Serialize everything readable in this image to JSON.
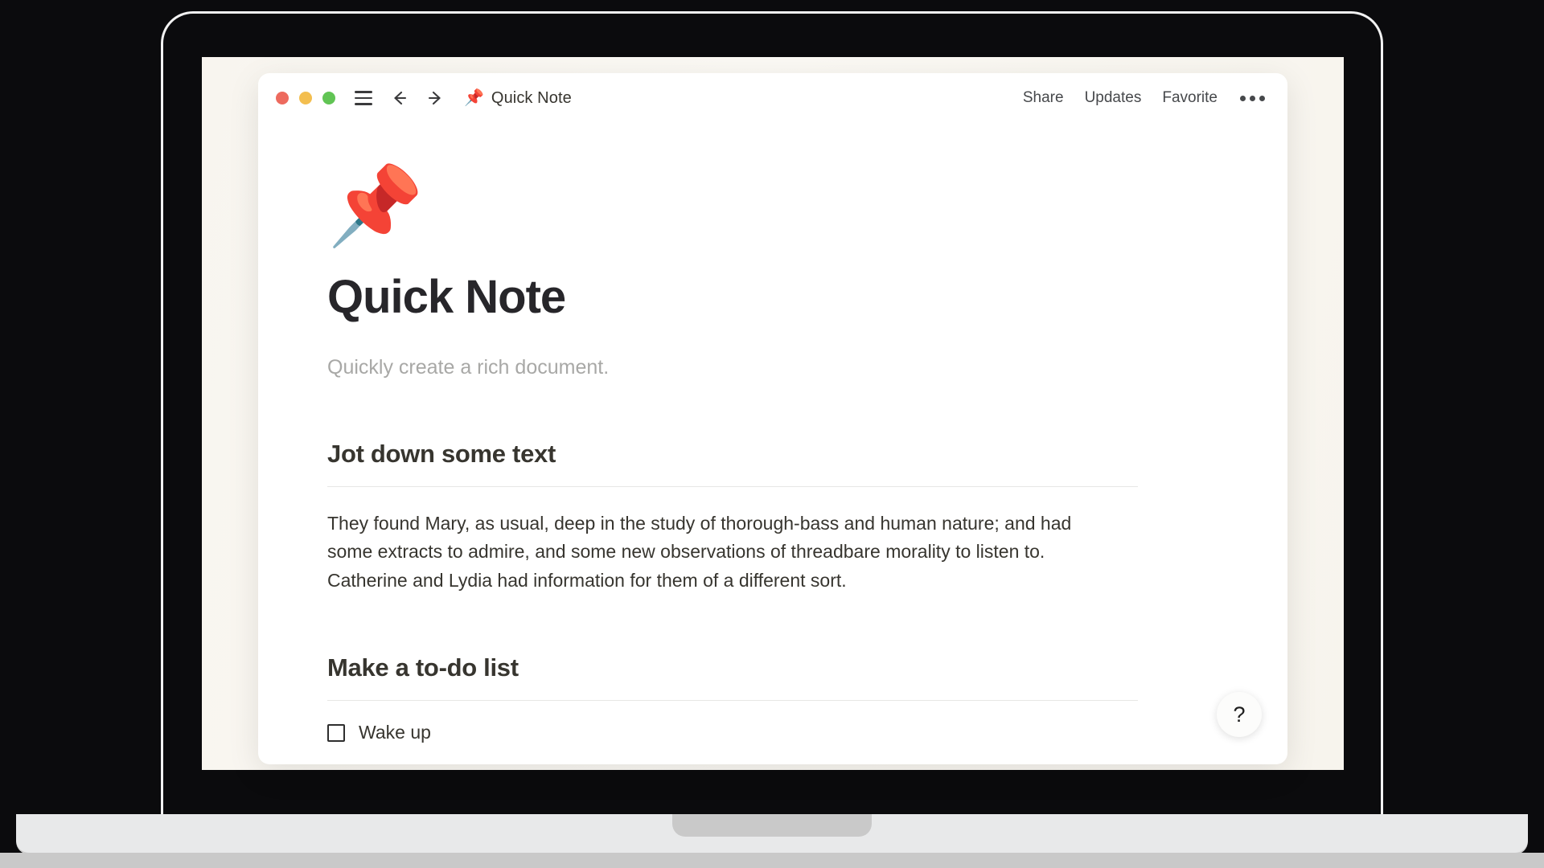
{
  "window": {
    "traffic_lights": [
      {
        "name": "close",
        "color": "#ED6A5E"
      },
      {
        "name": "minimize",
        "color": "#F3BE4F"
      },
      {
        "name": "maximize",
        "color": "#61C454"
      }
    ],
    "menu_icon": "hamburger-icon",
    "back_icon": "arrow-left-icon",
    "forward_icon": "arrow-right-icon",
    "doc_pin_emoji": "📌",
    "doc_title": "Quick Note",
    "actions": [
      {
        "label": "Share",
        "name": "share-button"
      },
      {
        "label": "Updates",
        "name": "updates-button"
      },
      {
        "label": "Favorite",
        "name": "favorite-button"
      }
    ],
    "more_icon": "ellipsis-icon"
  },
  "document": {
    "hero_emoji": "📌",
    "title": "Quick Note",
    "subtitle": "Quickly create a rich document.",
    "sections": [
      {
        "heading": "Jot down some text",
        "paragraph": "They found Mary, as usual, deep in the study of thorough-bass and human nature; and had some extracts to admire, and some new observations of threadbare morality to listen to. Catherine and Lydia had information for them of a different sort."
      },
      {
        "heading": "Make a to-do list",
        "todos": [
          {
            "label": "Wake up",
            "checked": false
          }
        ]
      }
    ]
  },
  "help": {
    "label": "?"
  },
  "colors": {
    "page_background": "#0B0B0D",
    "screen_background": "#F9F6F0",
    "window_background": "#FFFFFF",
    "text_primary": "#37352F",
    "text_muted": "#A8A8A6",
    "rule": "#E7E7E5",
    "laptop_base": "#E8E9EA"
  }
}
